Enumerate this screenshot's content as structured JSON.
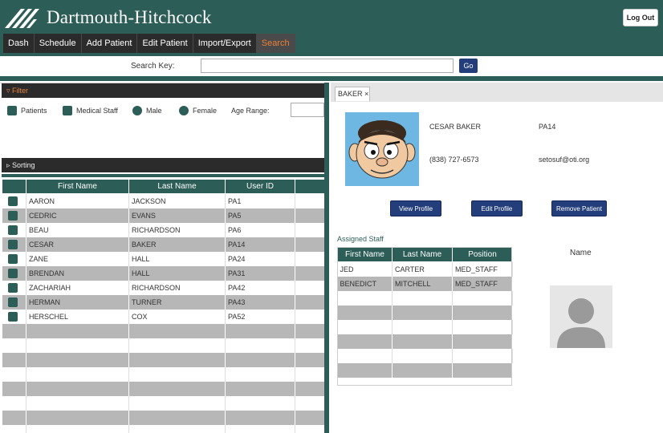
{
  "header": {
    "brand": "Dartmouth-Hitchcock",
    "logout_label": "Log Out",
    "colors": {
      "primary": "#2c5d57",
      "active_tab": "#e8813a",
      "button": "#233e7a"
    }
  },
  "nav": {
    "tabs": [
      {
        "label": "Dash"
      },
      {
        "label": "Schedule"
      },
      {
        "label": "Add Patient"
      },
      {
        "label": "Edit Patient"
      },
      {
        "label": "Import/Export"
      },
      {
        "label": "Search",
        "active": true
      }
    ]
  },
  "search": {
    "label": "Search Key:",
    "value": "",
    "go_label": "Go"
  },
  "filter": {
    "title": "Filter",
    "options": {
      "patients": "Patients",
      "medical_staff": "Medical Staff",
      "male": "Male",
      "female": "Female"
    },
    "age_range_label": "Age Range:",
    "age_range_value": ""
  },
  "sorting": {
    "title": "Sorting"
  },
  "patients_table": {
    "columns": [
      "",
      "First Name",
      "Last Name",
      "User ID",
      ""
    ],
    "rows": [
      {
        "first": "AARON",
        "last": "JACKSON",
        "id": "PA1"
      },
      {
        "first": "CEDRIC",
        "last": "EVANS",
        "id": "PA5"
      },
      {
        "first": "BEAU",
        "last": "RICHARDSON",
        "id": "PA6"
      },
      {
        "first": "CESAR",
        "last": "BAKER",
        "id": "PA14"
      },
      {
        "first": "ZANE",
        "last": "HALL",
        "id": "PA24"
      },
      {
        "first": "BRENDAN",
        "last": "HALL",
        "id": "PA31"
      },
      {
        "first": "ZACHARIAH",
        "last": "RICHARDSON",
        "id": "PA42"
      },
      {
        "first": "HERMAN",
        "last": "TURNER",
        "id": "PA43"
      },
      {
        "first": "HERSCHEL",
        "last": "COX",
        "id": "PA52"
      }
    ]
  },
  "detail": {
    "tab_label": "BAKER ×",
    "name": "CESAR BAKER",
    "user_id": "PA14",
    "phone": "(838) 727-6573",
    "email": "setosuf@oti.org",
    "buttons": {
      "view_profile": "View Profile",
      "edit_profile": "Edit Profile",
      "remove_patient": "Remove Patient"
    },
    "assigned_label": "Assigned Staff",
    "staff_columns": [
      "First Name",
      "Last Name",
      "Position"
    ],
    "staff_rows": [
      {
        "first": "JED",
        "last": "CARTER",
        "position": "MED_STAFF"
      },
      {
        "first": "BENEDICT",
        "last": "MITCHELL",
        "position": "MED_STAFF"
      }
    ],
    "name_label": "Name"
  }
}
